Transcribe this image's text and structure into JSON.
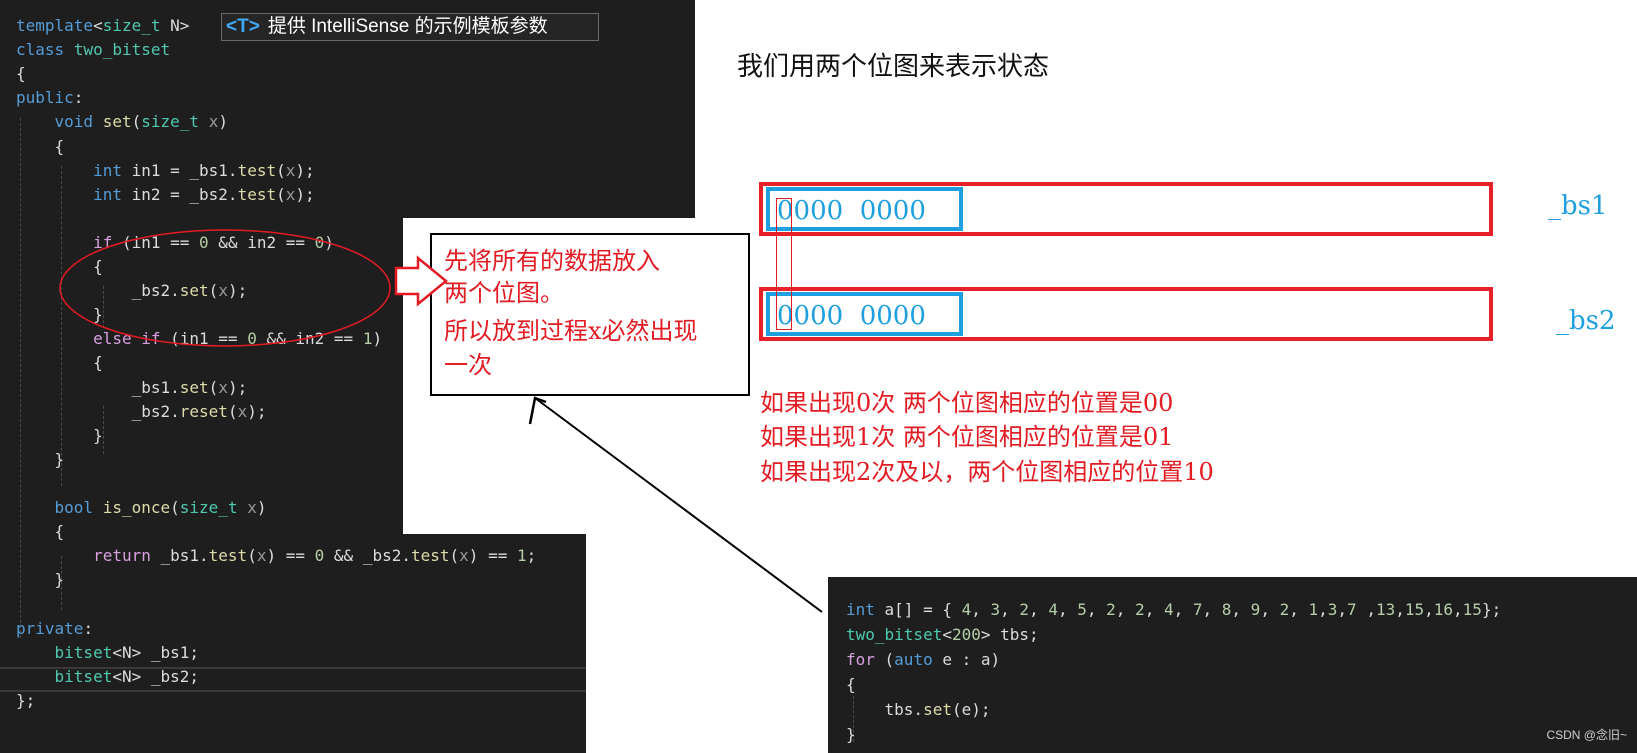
{
  "left_code": {
    "hint_box": {
      "tag": "<T>",
      "text": "提供 IntelliSense 的示例模板参数",
      "dropdown": "▾",
      "edit": "✎"
    },
    "lines": [
      [
        [
          "kw",
          "template"
        ],
        [
          "txt",
          "<"
        ],
        [
          "ty",
          "size_t"
        ],
        [
          "txt",
          " N>"
        ]
      ],
      [
        [
          "kw",
          "class"
        ],
        [
          "txt",
          " "
        ],
        [
          "ty",
          "two_bitset"
        ]
      ],
      [
        [
          "txt",
          "{"
        ]
      ],
      [
        [
          "kw",
          "public"
        ],
        [
          "txt",
          ":"
        ]
      ],
      [
        [
          "txt",
          "    "
        ],
        [
          "kw",
          "void"
        ],
        [
          "txt",
          " "
        ],
        [
          "fn",
          "set"
        ],
        [
          "txt",
          "("
        ],
        [
          "ty",
          "size_t"
        ],
        [
          "txt",
          " "
        ],
        [
          "prm",
          "x"
        ],
        [
          "txt",
          ")"
        ]
      ],
      [
        [
          "txt",
          "    {"
        ]
      ],
      [
        [
          "txt",
          "        "
        ],
        [
          "kw",
          "int"
        ],
        [
          "txt",
          " in1 = _bs1."
        ],
        [
          "fn",
          "test"
        ],
        [
          "txt",
          "("
        ],
        [
          "prm",
          "x"
        ],
        [
          "txt",
          ");"
        ]
      ],
      [
        [
          "txt",
          "        "
        ],
        [
          "kw",
          "int"
        ],
        [
          "txt",
          " in2 = _bs2."
        ],
        [
          "fn",
          "test"
        ],
        [
          "txt",
          "("
        ],
        [
          "prm",
          "x"
        ],
        [
          "txt",
          ");"
        ]
      ],
      [
        [
          "txt",
          ""
        ]
      ],
      [
        [
          "txt",
          "        "
        ],
        [
          "ctl",
          "if"
        ],
        [
          "txt",
          " (in1 == "
        ],
        [
          "num",
          "0"
        ],
        [
          "txt",
          " && in2 == "
        ],
        [
          "num",
          "0"
        ],
        [
          "txt",
          ")"
        ]
      ],
      [
        [
          "txt",
          "        {"
        ]
      ],
      [
        [
          "txt",
          "            _bs2."
        ],
        [
          "fn",
          "set"
        ],
        [
          "txt",
          "("
        ],
        [
          "prm",
          "x"
        ],
        [
          "txt",
          ");"
        ]
      ],
      [
        [
          "txt",
          "        }"
        ]
      ],
      [
        [
          "txt",
          "        "
        ],
        [
          "ctl",
          "else if"
        ],
        [
          "txt",
          " (in1 == "
        ],
        [
          "num",
          "0"
        ],
        [
          "txt",
          " && in2 == "
        ],
        [
          "num",
          "1"
        ],
        [
          "txt",
          ")"
        ]
      ],
      [
        [
          "txt",
          "        {"
        ]
      ],
      [
        [
          "txt",
          "            _bs1."
        ],
        [
          "fn",
          "set"
        ],
        [
          "txt",
          "("
        ],
        [
          "prm",
          "x"
        ],
        [
          "txt",
          ");"
        ]
      ],
      [
        [
          "txt",
          "            _bs2."
        ],
        [
          "fn",
          "reset"
        ],
        [
          "txt",
          "("
        ],
        [
          "prm",
          "x"
        ],
        [
          "txt",
          ");"
        ]
      ],
      [
        [
          "txt",
          "        }"
        ]
      ],
      [
        [
          "txt",
          "    }"
        ]
      ],
      [
        [
          "txt",
          ""
        ]
      ],
      [
        [
          "txt",
          "    "
        ],
        [
          "kw",
          "bool"
        ],
        [
          "txt",
          " "
        ],
        [
          "fn",
          "is_once"
        ],
        [
          "txt",
          "("
        ],
        [
          "ty",
          "size_t"
        ],
        [
          "txt",
          " "
        ],
        [
          "prm",
          "x"
        ],
        [
          "txt",
          ")"
        ]
      ],
      [
        [
          "txt",
          "    {"
        ]
      ],
      [
        [
          "txt",
          "        "
        ],
        [
          "ctl",
          "return"
        ],
        [
          "txt",
          " _bs1."
        ],
        [
          "fn",
          "test"
        ],
        [
          "txt",
          "("
        ],
        [
          "prm",
          "x"
        ],
        [
          "txt",
          ") == "
        ],
        [
          "num",
          "0"
        ],
        [
          "txt",
          " && _bs2."
        ],
        [
          "fn",
          "test"
        ],
        [
          "txt",
          "("
        ],
        [
          "prm",
          "x"
        ],
        [
          "txt",
          ") == "
        ],
        [
          "num",
          "1"
        ],
        [
          "txt",
          ";"
        ]
      ],
      [
        [
          "txt",
          "    }"
        ]
      ],
      [
        [
          "txt",
          ""
        ]
      ],
      [
        [
          "kw",
          "private"
        ],
        [
          "txt",
          ":"
        ]
      ],
      [
        [
          "txt",
          "    "
        ],
        [
          "ty",
          "bitset"
        ],
        [
          "txt",
          "<N> _bs1;"
        ]
      ],
      [
        [
          "txt",
          "    "
        ],
        [
          "ty",
          "bitset"
        ],
        [
          "txt",
          "<N> _bs2;"
        ]
      ],
      [
        [
          "txt",
          "};"
        ]
      ]
    ]
  },
  "bottom_code": {
    "lines": [
      [
        [
          "kw",
          "int"
        ],
        [
          "txt",
          " a[] = { "
        ],
        [
          "num",
          "4"
        ],
        [
          "txt",
          ", "
        ],
        [
          "num",
          "3"
        ],
        [
          "txt",
          ", "
        ],
        [
          "num",
          "2"
        ],
        [
          "txt",
          ", "
        ],
        [
          "num",
          "4"
        ],
        [
          "txt",
          ", "
        ],
        [
          "num",
          "5"
        ],
        [
          "txt",
          ", "
        ],
        [
          "num",
          "2"
        ],
        [
          "txt",
          ", "
        ],
        [
          "num",
          "2"
        ],
        [
          "txt",
          ", "
        ],
        [
          "num",
          "4"
        ],
        [
          "txt",
          ", "
        ],
        [
          "num",
          "7"
        ],
        [
          "txt",
          ", "
        ],
        [
          "num",
          "8"
        ],
        [
          "txt",
          ", "
        ],
        [
          "num",
          "9"
        ],
        [
          "txt",
          ", "
        ],
        [
          "num",
          "2"
        ],
        [
          "txt",
          ", "
        ],
        [
          "num",
          "1"
        ],
        [
          "txt",
          ","
        ],
        [
          "num",
          "3"
        ],
        [
          "txt",
          ","
        ],
        [
          "num",
          "7"
        ],
        [
          "txt",
          " ,"
        ],
        [
          "num",
          "13"
        ],
        [
          "txt",
          ","
        ],
        [
          "num",
          "15"
        ],
        [
          "txt",
          ","
        ],
        [
          "num",
          "16"
        ],
        [
          "txt",
          ","
        ],
        [
          "num",
          "15"
        ],
        [
          "txt",
          "};"
        ]
      ],
      [
        [
          "ty",
          "two_bitset"
        ],
        [
          "txt",
          "<"
        ],
        [
          "num",
          "200"
        ],
        [
          "txt",
          "> tbs;"
        ]
      ],
      [
        [
          "ctl",
          "for"
        ],
        [
          "txt",
          " ("
        ],
        [
          "kw",
          "auto"
        ],
        [
          "txt",
          " e : a)"
        ]
      ],
      [
        [
          "txt",
          "{"
        ]
      ],
      [
        [
          "txt",
          "    tbs."
        ],
        [
          "fn",
          "set"
        ],
        [
          "txt",
          "(e);"
        ]
      ],
      [
        [
          "txt",
          "}"
        ]
      ]
    ]
  },
  "heading": "我们用两个位图来表示状态",
  "bitmaps": [
    {
      "bits": "0000  0000",
      "label": "_bs1"
    },
    {
      "bits": "0000  0000",
      "label": "_bs2"
    }
  ],
  "explanations": [
    "如果出现0次  两个位图相应的位置是00",
    "如果出现1次  两个位图相应的位置是01",
    "如果出现2次及以，两个位图相应的位置10"
  ],
  "note": {
    "lines": [
      "先将所有的数据放入",
      "两个位图。",
      "所以放到过程x必然出现",
      "一次"
    ]
  },
  "colors": {
    "annotation_red": "#e31b23",
    "bitmap_blue": "#1ea0e0",
    "editor_bg": "#1e1e1e"
  },
  "watermark": "CSDN @念旧~"
}
